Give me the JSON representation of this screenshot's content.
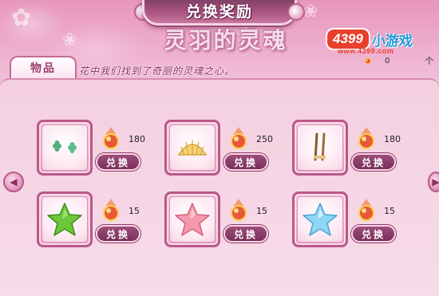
{
  "header": {
    "title": "兑换奖励",
    "subtitle": "灵羽的灵魂",
    "story": "花中我们找到了奇丽的灵魂之心。"
  },
  "logo": {
    "number": "4399",
    "text": "小游戏",
    "url": "www.4399.com"
  },
  "counter": {
    "value": "0",
    "unit": "个"
  },
  "tab": {
    "label": "物品"
  },
  "items": [
    {
      "name": "clover-earrings",
      "price": "180",
      "button": "兑换"
    },
    {
      "name": "golden-shell",
      "price": "250",
      "button": "兑换"
    },
    {
      "name": "wooden-chopsticks",
      "price": "180",
      "button": "兑换"
    },
    {
      "name": "green-star",
      "price": "15",
      "button": "兑换"
    },
    {
      "name": "pink-star",
      "price": "15",
      "button": "兑换"
    },
    {
      "name": "blue-star",
      "price": "15",
      "button": "兑换"
    }
  ],
  "icons": {
    "currency": "fire-gem-icon",
    "prev": "arrow-left-icon",
    "next": "arrow-right-icon"
  },
  "colors": {
    "accent": "#b9588a",
    "button": "#7a2f5a",
    "logo_red": "#e8402c",
    "logo_blue": "#1d9bd8"
  }
}
